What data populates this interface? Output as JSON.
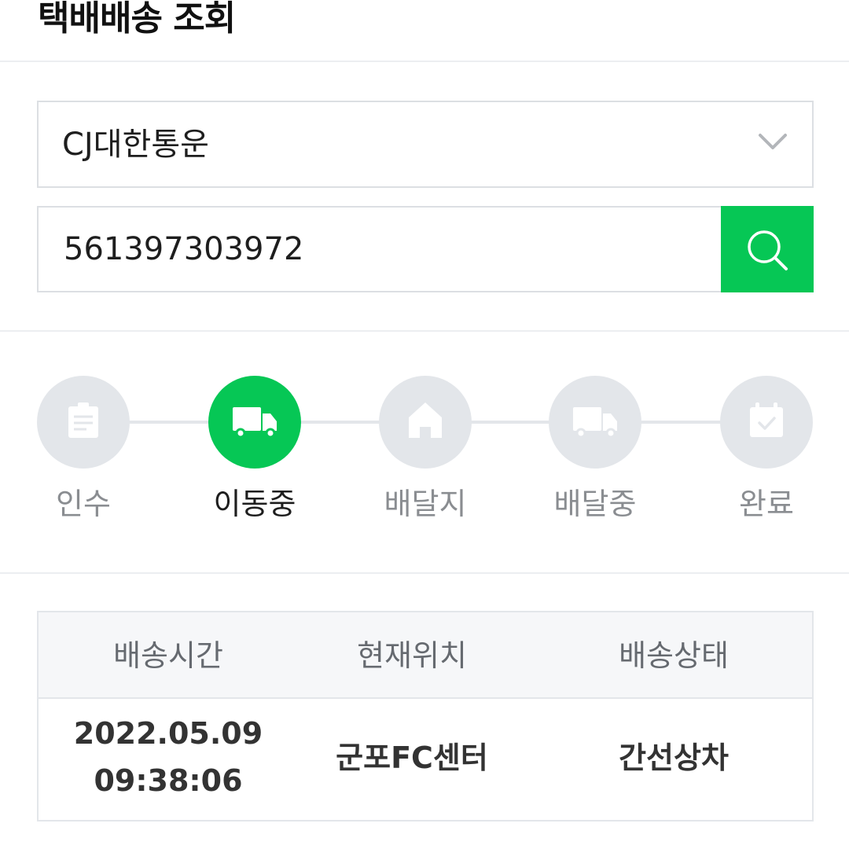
{
  "header": {
    "title": "택배배송 조회"
  },
  "carrier": {
    "selected": "CJ대한통운"
  },
  "search": {
    "tracking_number": "561397303972"
  },
  "steps": [
    {
      "label": "인수",
      "icon": "receipt-icon",
      "active": false
    },
    {
      "label": "이동중",
      "icon": "truck-icon",
      "active": true
    },
    {
      "label": "배달지",
      "icon": "house-icon",
      "active": false
    },
    {
      "label": "배달중",
      "icon": "delivery-truck-icon",
      "active": false
    },
    {
      "label": "완료",
      "icon": "calendar-check-icon",
      "active": false
    }
  ],
  "table": {
    "headers": [
      "배송시간",
      "현재위치",
      "배송상태"
    ],
    "rows": [
      {
        "date": "2022.05.09",
        "time": "09:38:06",
        "location": "군포FC센터",
        "status": "간선상차"
      }
    ]
  },
  "colors": {
    "accent": "#06c755",
    "inactive": "#e3e6ea",
    "border": "#dcdfe3",
    "header_bg": "#f6f7f9"
  }
}
